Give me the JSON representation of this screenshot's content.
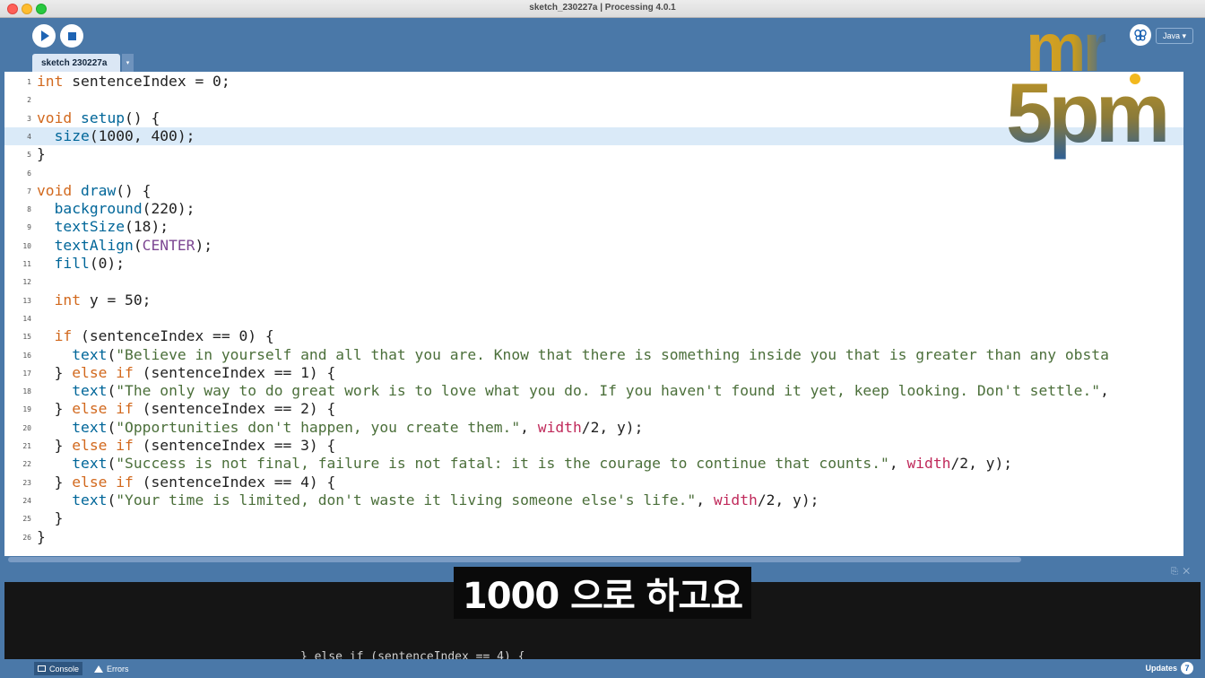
{
  "window": {
    "title": "sketch_230227a | Processing 4.0.1"
  },
  "toolbar": {
    "run_icon": "play-icon",
    "stop_icon": "stop-icon",
    "debug_icon": "butterfly-icon",
    "mode_label": "Java ▾"
  },
  "tabs": [
    {
      "label": "sketch 230227a"
    }
  ],
  "tab_menu": "▾",
  "editor": {
    "highlighted_line": 4,
    "lines": [
      {
        "n": "1",
        "code": "int sentenceIndex = 0;"
      },
      {
        "n": "2",
        "code": ""
      },
      {
        "n": "3",
        "code": "void setup() {"
      },
      {
        "n": "4",
        "code": "  size(1000, 400);"
      },
      {
        "n": "5",
        "code": "}"
      },
      {
        "n": "6",
        "code": ""
      },
      {
        "n": "7",
        "code": "void draw() {"
      },
      {
        "n": "8",
        "code": "  background(220);"
      },
      {
        "n": "9",
        "code": "  textSize(18);"
      },
      {
        "n": "10",
        "code": "  textAlign(CENTER);"
      },
      {
        "n": "11",
        "code": "  fill(0);"
      },
      {
        "n": "12",
        "code": ""
      },
      {
        "n": "13",
        "code": "  int y = 50;"
      },
      {
        "n": "14",
        "code": ""
      },
      {
        "n": "15",
        "code": "  if (sentenceIndex == 0) {"
      },
      {
        "n": "16",
        "code": "    text(\"Believe in yourself and all that you are. Know that there is something inside you that is greater than any obsta"
      },
      {
        "n": "17",
        "code": "  } else if (sentenceIndex == 1) {"
      },
      {
        "n": "18",
        "code": "    text(\"The only way to do great work is to love what you do. If you haven't found it yet, keep looking. Don't settle.\","
      },
      {
        "n": "19",
        "code": "  } else if (sentenceIndex == 2) {"
      },
      {
        "n": "20",
        "code": "    text(\"Opportunities don't happen, you create them.\", width/2, y);"
      },
      {
        "n": "21",
        "code": "  } else if (sentenceIndex == 3) {"
      },
      {
        "n": "22",
        "code": "    text(\"Success is not final, failure is not fatal: it is the courage to continue that counts.\", width/2, y);"
      },
      {
        "n": "23",
        "code": "  } else if (sentenceIndex == 4) {"
      },
      {
        "n": "24",
        "code": "    text(\"Your time is limited, don't waste it living someone else's life.\", width/2, y);"
      },
      {
        "n": "25",
        "code": "  }"
      },
      {
        "n": "26",
        "code": "}"
      }
    ]
  },
  "console": {
    "output_text": "} else if (sentenceIndex == 4) {",
    "tab_console": "Console",
    "tab_errors": "Errors",
    "updates_label": "Updates",
    "updates_count": "7"
  },
  "subtitle": {
    "text": "1000 으로 하고요"
  },
  "logo": {
    "line1": "mr",
    "line2": "5pm"
  },
  "colors": {
    "ide_blue": "#4a78a8",
    "highlight": "#daeaf8",
    "keyword": "#d2691e",
    "function": "#006699",
    "string": "#4b6f3a",
    "builtin_var": "#c02a5b",
    "constant": "#7d4793"
  }
}
